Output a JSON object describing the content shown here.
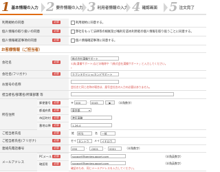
{
  "steps": [
    {
      "num": "1",
      "label": "基本情報の入力"
    },
    {
      "num": "2",
      "label": "要件情報の入力"
    },
    {
      "num": "3",
      "label": "利用者情報の入力"
    },
    {
      "num": "4",
      "label": "確認画面"
    },
    {
      "num": "5",
      "label": "注文完了"
    }
  ],
  "required_badge": "必須",
  "agreements": [
    {
      "label": "利用規約の同意",
      "text": "利用規約に同意する。"
    },
    {
      "label": "個人情報の取り扱いの同意",
      "text": "弊社をもって法律等の根拠及び権利を認め利用者の個人情報を取り扱うことに同意する。"
    },
    {
      "label": "個人情報確認事項の同意",
      "text": "個人情報確認事項に同意する。"
    }
  ],
  "section_title": "お客様情報（ご担当者）",
  "company": {
    "label": "会社名",
    "value": "株式会社漢備サポート",
    "hint1": "①具(漢備サポート)などの略称や「(株式会社漢備サポート」と入力してください。",
    "hint2": "。"
  },
  "company_kana": {
    "label": "会社名(フリガナ)",
    "value": "カブシキガイシャ(カンビサポート"
  },
  "brand": {
    "label": "お屋号の名称",
    "hint": "会社名と同じ名称の場合は、屋号会社名の入力の必要はありません。"
  },
  "dept": {
    "label": "担当者名/部署名/所属部署 等"
  },
  "address": {
    "label": "所在住所",
    "postal_label": "郵便番号",
    "postal_mark": "〒",
    "postal1": "000",
    "postal2": "0045",
    "postal_note": "（半角数字）",
    "pref_label": "都道府県",
    "pref_value": "東京都",
    "city_label": "市区町村",
    "city_value": "港区高輪",
    "addr_label": "番地以降",
    "addr_value": "1-26-4"
  },
  "person": {
    "label": "ご担当者氏名",
    "sei": "姓",
    "sei_value": "担当",
    "mei": "名",
    "mei_value": "一郎"
  },
  "person_kana": {
    "label": "ご担当者氏名(フリガナ)",
    "sei": "セイ",
    "sei_value": "タントウ",
    "mei": "メイ",
    "mei_value": "イチロウ"
  },
  "phone": {
    "label": "連絡先電話番号",
    "v1": "090",
    "v2": "-0001",
    "v3": "0001",
    "note": "（半角数字）"
  },
  "email": {
    "label": "メールアドレス",
    "pc_label": "PCメール",
    "pc_value": "support@gentesupport.com",
    "pc_note": "（半角英数字）",
    "confirm_label": "確認用",
    "confirm_value": "support@gentesupport.com",
    "confirm_note": "（半角英数字）",
    "confirm_hint": "確認のため、同じメールアドレスを入力してください。"
  }
}
